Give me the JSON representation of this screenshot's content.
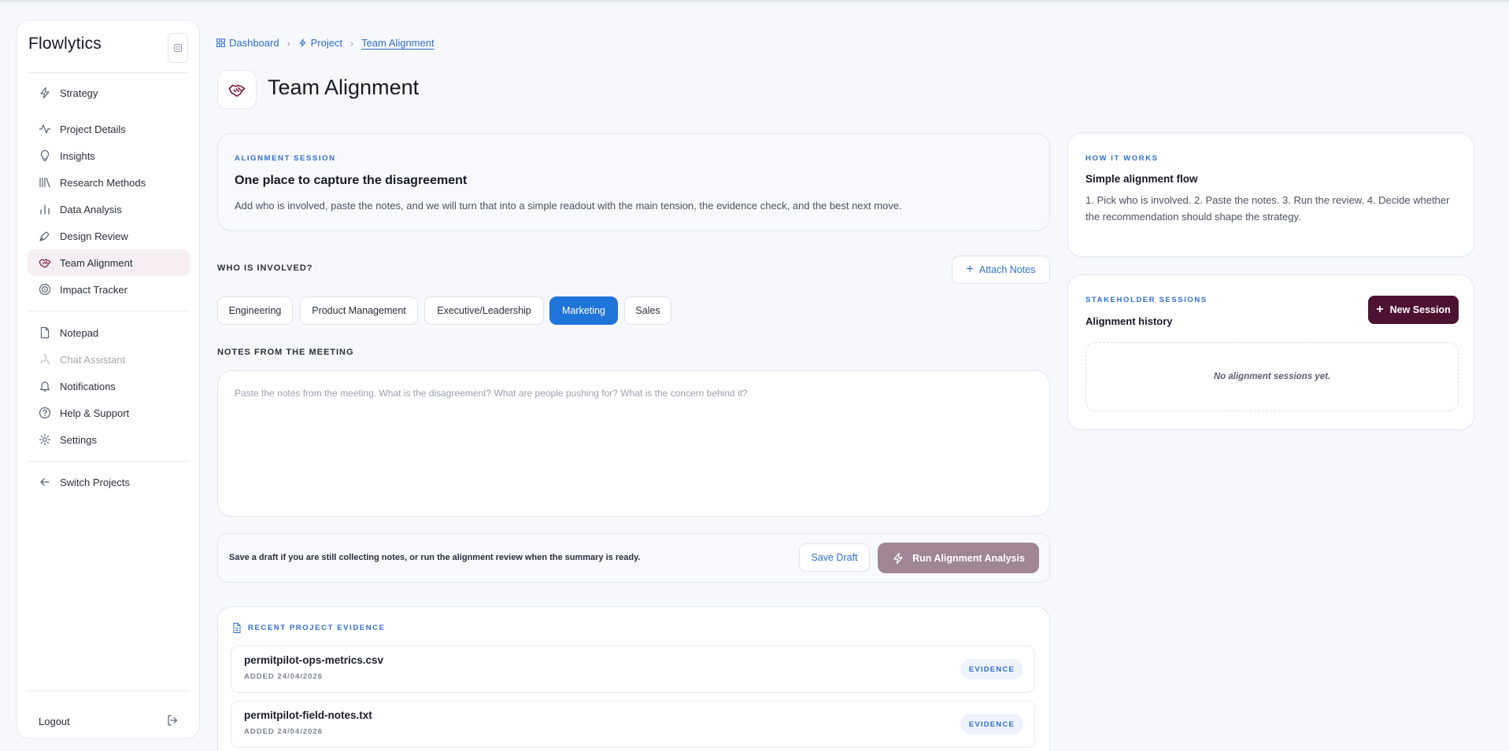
{
  "app": {
    "brand": "Flowlytics"
  },
  "sidebar": {
    "primary": [
      {
        "label": "Strategy",
        "icon": "bolt-icon"
      },
      {
        "label": "Project Details",
        "icon": "activity-icon"
      },
      {
        "label": "Insights",
        "icon": "lightbulb-icon"
      },
      {
        "label": "Research Methods",
        "icon": "library-icon"
      },
      {
        "label": "Data Analysis",
        "icon": "bar-chart-icon"
      },
      {
        "label": "Design Review",
        "icon": "pen-tool-icon"
      },
      {
        "label": "Team Alignment",
        "icon": "handshake-icon",
        "active": true
      },
      {
        "label": "Impact Tracker",
        "icon": "target-icon"
      }
    ],
    "secondary": [
      {
        "label": "Notepad",
        "icon": "file-icon"
      },
      {
        "label": "Chat Assistant",
        "icon": "bot-icon",
        "disabled": true
      },
      {
        "label": "Notifications",
        "icon": "bell-icon"
      },
      {
        "label": "Help & Support",
        "icon": "help-circle-icon"
      },
      {
        "label": "Settings",
        "icon": "gear-icon"
      }
    ],
    "switch_projects": "Switch Projects",
    "logout": "Logout"
  },
  "breadcrumb": {
    "items": [
      "Dashboard",
      "Project",
      "Team Alignment"
    ]
  },
  "page": {
    "title": "Team Alignment"
  },
  "session_card": {
    "eyebrow": "ALIGNMENT SESSION",
    "title": "One place to capture the disagreement",
    "text": "Add who is involved, paste the notes, and we will turn that into a simple readout with the main tension, the evidence check, and the best next move."
  },
  "involved": {
    "label": "WHO IS INVOLVED?",
    "attach_label": "Attach Notes",
    "chips": [
      "Engineering",
      "Product Management",
      "Executive/Leadership",
      "Marketing",
      "Sales"
    ],
    "selected": "Marketing"
  },
  "notes": {
    "label": "NOTES FROM THE MEETING",
    "placeholder": "Paste the notes from the meeting. What is the disagreement? What are people pushing for? What is the concern behind it?"
  },
  "action_bar": {
    "text": "Save a draft if you are still collecting notes, or run the alignment review when the summary is ready.",
    "save_label": "Save Draft",
    "run_label": "Run Alignment Analysis"
  },
  "evidence": {
    "eyebrow": "RECENT PROJECT EVIDENCE",
    "items": [
      {
        "name": "permitpilot-ops-metrics.csv",
        "date": "ADDED 24/04/2026",
        "badge": "EVIDENCE"
      },
      {
        "name": "permitpilot-field-notes.txt",
        "date": "ADDED 24/04/2026",
        "badge": "EVIDENCE"
      }
    ]
  },
  "how_it_works": {
    "eyebrow": "HOW IT WORKS",
    "title": "Simple alignment flow",
    "text": "1. Pick who is involved. 2. Paste the notes. 3. Run the review. 4. Decide whether the recommendation should shape the strategy."
  },
  "stakeholder": {
    "eyebrow": "STAKEHOLDER SESSIONS",
    "title": "Alignment history",
    "new_label": "New Session",
    "empty_text": "No alignment sessions yet."
  },
  "colors": {
    "accent_blue": "#1f74d9",
    "brand_plum": "#4d1231",
    "muted_plum": "#a08595"
  }
}
